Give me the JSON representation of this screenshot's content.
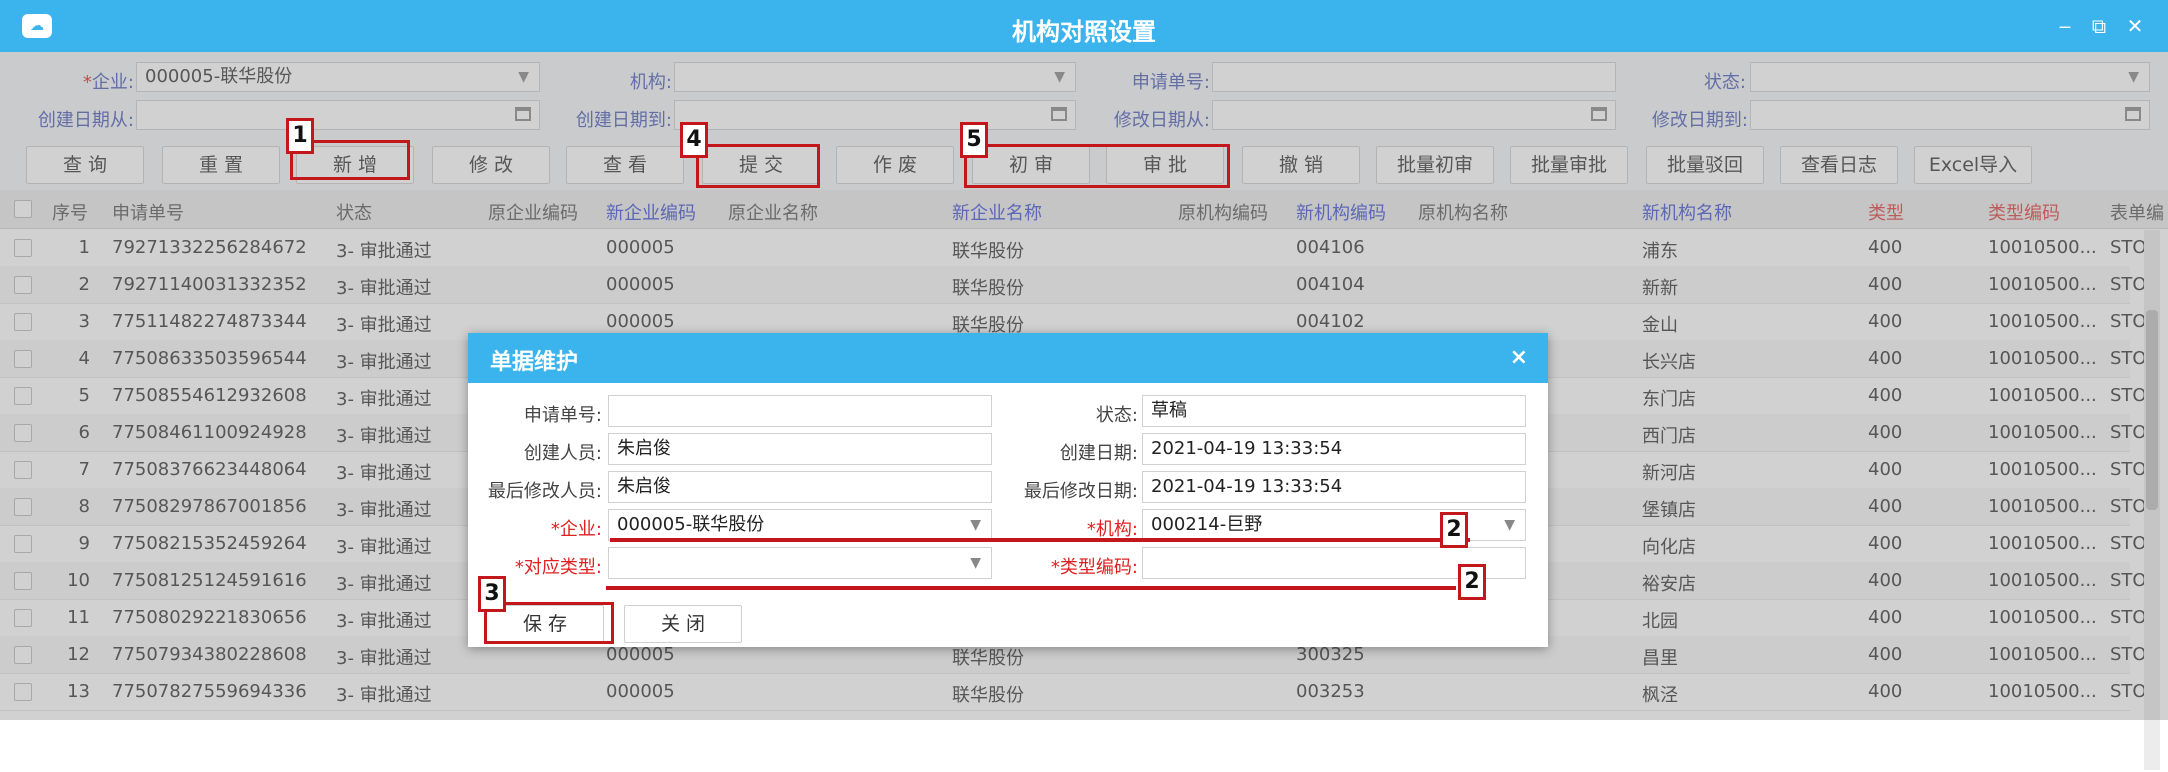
{
  "window": {
    "title": "机构对照设置"
  },
  "filters": {
    "enterprise_label": "企业:",
    "enterprise_value": "000005-联华股份",
    "org_label": "机构:",
    "org_value": "",
    "request_no_label": "申请单号:",
    "request_no_value": "",
    "status_label": "状态:",
    "status_value": "",
    "created_from_label": "创建日期从:",
    "created_to_label": "创建日期到:",
    "modified_from_label": "修改日期从:",
    "modified_to_label": "修改日期到:"
  },
  "toolbar": {
    "query": "查 询",
    "reset": "重 置",
    "add": "新 增",
    "edit": "修 改",
    "view": "查 看",
    "submit": "提 交",
    "void": "作 废",
    "first_review": "初 审",
    "approve": "审 批",
    "revoke": "撤 销",
    "batch_first_review": "批量初审",
    "batch_approve": "批量审批",
    "batch_reject": "批量驳回",
    "view_log": "查看日志",
    "excel_import": "Excel导入"
  },
  "grid": {
    "headers": [
      "序号",
      "申请单号",
      "状态",
      "原企业编码",
      "新企业编码",
      "原企业名称",
      "新企业名称",
      "原机构编码",
      "新机构编码",
      "原机构名称",
      "新机构名称",
      "类型",
      "类型编码",
      "表单编"
    ],
    "rows": [
      {
        "no": "1",
        "req": "79271332256284672",
        "status": "3- 审批通过",
        "ent": "000005",
        "ent_name": "联华股份",
        "org": "004106",
        "org_name": "浦东",
        "type": "400",
        "type_code": "10010500...",
        "form": "STO"
      },
      {
        "no": "2",
        "req": "79271140031332352",
        "status": "3- 审批通过",
        "ent": "000005",
        "ent_name": "联华股份",
        "org": "004104",
        "org_name": "新新",
        "type": "400",
        "type_code": "10010500...",
        "form": "STO"
      },
      {
        "no": "3",
        "req": "77511482274873344",
        "status": "3- 审批通过",
        "ent": "000005",
        "ent_name": "联华股份",
        "org": "004102",
        "org_name": "金山",
        "type": "400",
        "type_code": "10010500...",
        "form": "STO"
      },
      {
        "no": "4",
        "req": "77508633503596544",
        "status": "3- 审批通过",
        "ent": "",
        "ent_name": "",
        "org": "",
        "org_name": "长兴店",
        "type": "400",
        "type_code": "10010500...",
        "form": "STO"
      },
      {
        "no": "5",
        "req": "77508554612932608",
        "status": "3- 审批通过",
        "ent": "",
        "ent_name": "",
        "org": "",
        "org_name": "东门店",
        "type": "400",
        "type_code": "10010500...",
        "form": "STO"
      },
      {
        "no": "6",
        "req": "77508461100924928",
        "status": "3- 审批通过",
        "ent": "",
        "ent_name": "",
        "org": "",
        "org_name": "西门店",
        "type": "400",
        "type_code": "10010500...",
        "form": "STO"
      },
      {
        "no": "7",
        "req": "77508376623448064",
        "status": "3- 审批通过",
        "ent": "",
        "ent_name": "",
        "org": "",
        "org_name": "新河店",
        "type": "400",
        "type_code": "10010500...",
        "form": "STO"
      },
      {
        "no": "8",
        "req": "77508297867001856",
        "status": "3- 审批通过",
        "ent": "",
        "ent_name": "",
        "org": "",
        "org_name": "堡镇店",
        "type": "400",
        "type_code": "10010500...",
        "form": "STO"
      },
      {
        "no": "9",
        "req": "77508215352459264",
        "status": "3- 审批通过",
        "ent": "",
        "ent_name": "",
        "org": "",
        "org_name": "向化店",
        "type": "400",
        "type_code": "10010500...",
        "form": "STO"
      },
      {
        "no": "10",
        "req": "77508125124591616",
        "status": "3- 审批通过",
        "ent": "",
        "ent_name": "",
        "org": "",
        "org_name": "裕安店",
        "type": "400",
        "type_code": "10010500...",
        "form": "STO"
      },
      {
        "no": "11",
        "req": "77508029221830656",
        "status": "3- 审批通过",
        "ent": "",
        "ent_name": "",
        "org": "",
        "org_name": "北园",
        "type": "400",
        "type_code": "10010500...",
        "form": "STO"
      },
      {
        "no": "12",
        "req": "77507934380228608",
        "status": "3- 审批通过",
        "ent": "000005",
        "ent_name": "联华股份",
        "org": "300325",
        "org_name": "昌里",
        "type": "400",
        "type_code": "10010500...",
        "form": "STO"
      },
      {
        "no": "13",
        "req": "77507827559694336",
        "status": "3- 审批通过",
        "ent": "000005",
        "ent_name": "联华股份",
        "org": "003253",
        "org_name": "枫泾",
        "type": "400",
        "type_code": "10010500...",
        "form": "STO"
      }
    ]
  },
  "dialog": {
    "title": "单据维护",
    "close": "×",
    "request_no_label": "申请单号:",
    "request_no_value": "",
    "status_label": "状态:",
    "status_value": "草稿",
    "creator_label": "创建人员:",
    "creator_value": "朱启俊",
    "created_date_label": "创建日期:",
    "created_date_value": "2021-04-19 13:33:54",
    "last_modifier_label": "最后修改人员:",
    "last_modifier_value": "朱启俊",
    "last_modified_date_label": "最后修改日期:",
    "last_modified_date_value": "2021-04-19 13:33:54",
    "enterprise_label": "*企业:",
    "enterprise_value": "000005-联华股份",
    "org_label": "*机构:",
    "org_value": "000214-巨野",
    "map_type_label": "*对应类型:",
    "map_type_value": "",
    "type_code_label": "*类型编码:",
    "type_code_value": "",
    "save": "保 存",
    "close_btn": "关 闭"
  },
  "annotations": {
    "n1": "1",
    "n2a": "2",
    "n2b": "2",
    "n3": "3",
    "n4": "4",
    "n5": "5"
  },
  "colors": {
    "accent": "#3bb4ee",
    "annotation": "#c4171b",
    "required": "#e02020"
  }
}
